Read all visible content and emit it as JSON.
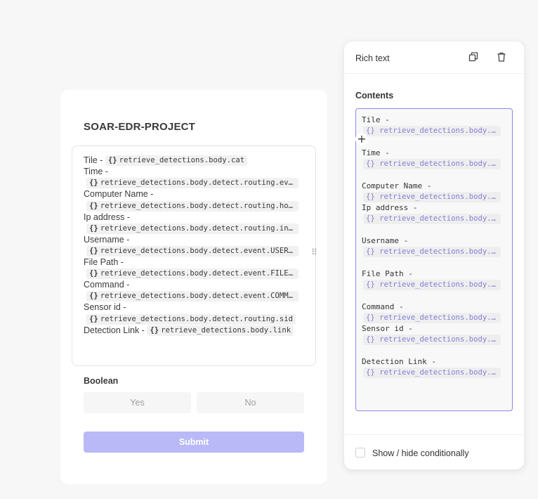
{
  "form": {
    "title": "SOAR-EDR-PROJECT",
    "rich_text_rows": [
      {
        "label": "Tile -",
        "chip": "retrieve_detections.body.cat",
        "inline": true
      },
      {
        "label": "Time -",
        "chip": "retrieve_detections.body.detect.routing.event_time",
        "inline": false
      },
      {
        "label": "Computer Name -",
        "chip": "retrieve_detections.body.detect.routing.hostname",
        "inline": false
      },
      {
        "label": "Ip address -",
        "chip": "retrieve_detections.body.detect.routing.int_ip",
        "inline": false
      },
      {
        "label": "Username -",
        "chip": "retrieve_detections.body.detect.event.USER_NAME",
        "inline": false
      },
      {
        "label": "File Path -",
        "chip": "retrieve_detections.body.detect.event.FILE_PATH",
        "inline": false
      },
      {
        "label": "Command -",
        "chip": "retrieve_detections.body.detect.event.COMMAND_LINE",
        "inline": false
      },
      {
        "label": "Sensor id -",
        "chip": "retrieve_detections.body.detect.routing.sid",
        "inline": false
      },
      {
        "label": "Detection Link -",
        "chip": "retrieve_detections.body.link",
        "inline": true
      }
    ],
    "chip_brace": "{}",
    "boolean_label": "Boolean",
    "yes_label": "Yes",
    "no_label": "No",
    "submit_label": "Submit",
    "drag_handle_glyph": "⠿"
  },
  "panel": {
    "title": "Rich text",
    "contents_label": "Contents",
    "plus_glyph": "+",
    "editor_lines": {
      "tile_label": "Tile -",
      "tile_chip": "retrieve_detections.body.cat",
      "time_label": "Time -",
      "time_chip": "retrieve_detections.body.detect.routing.event_time",
      "computer_label": "Computer Name -",
      "computer_chip": "retrieve_detections.body.detect.routing.hostname",
      "ip_label": "Ip address -",
      "ip_chip": "retrieve_detections.body.detect.routing.int_ip",
      "username_label": "Username -",
      "username_chip": "retrieve_detections.body.detect.event.USER_NAME",
      "filepath_label": "File Path -",
      "filepath_chip": "retrieve_detections.body.detect.event.FILE_PATH",
      "command_label": "Command -",
      "command_chip": "retrieve_detections.body.detect.event.COMMAND_LINE",
      "sensor_label": "Sensor id -",
      "sensor_chip": "retrieve_detections.body.detect.routing.sid",
      "link_label": "Detection Link -",
      "link_chip": "retrieve_detections.body.link"
    },
    "footer_label": "Show / hide conditionally",
    "accent_color": "#8c87ea",
    "chip_text_color": "#8580d8",
    "submit_color": "#b9b9f7"
  }
}
